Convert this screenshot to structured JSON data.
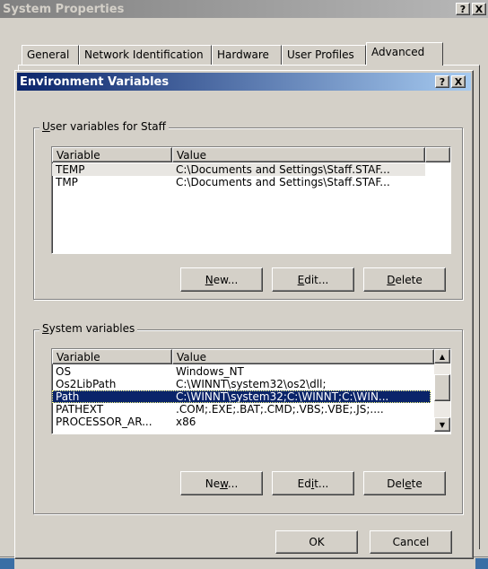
{
  "outer_window": {
    "title": "System Properties",
    "help_button": "?",
    "close_button": "X",
    "tabs": [
      "General",
      "Network Identification",
      "Hardware",
      "User Profiles",
      "Advanced"
    ],
    "active_tab": "Advanced"
  },
  "dialog": {
    "title": "Environment Variables",
    "help_button": "?",
    "close_button": "X",
    "user_group": {
      "label_accel": "U",
      "label_rest": "ser variables for Staff",
      "columns": [
        "Variable",
        "Value"
      ],
      "rows": [
        {
          "variable": "TEMP",
          "value": "C:\\Documents and Settings\\Staff.STAF..."
        },
        {
          "variable": "TMP",
          "value": "C:\\Documents and Settings\\Staff.STAF..."
        }
      ],
      "buttons": {
        "new_accel": "N",
        "new_rest": "ew...",
        "edit_accel": "E",
        "edit_rest": "dit...",
        "delete_accel": "D",
        "delete_rest": "elete"
      }
    },
    "system_group": {
      "label_accel": "S",
      "label_rest": "ystem variables",
      "columns": [
        "Variable",
        "Value"
      ],
      "rows": [
        {
          "variable": "OS",
          "value": "Windows_NT"
        },
        {
          "variable": "Os2LibPath",
          "value": "C:\\WINNT\\system32\\os2\\dll;"
        },
        {
          "variable": "Path",
          "value": "C:\\WINNT\\system32;C:\\WINNT;C:\\WIN..."
        },
        {
          "variable": "PATHEXT",
          "value": ".COM;.EXE;.BAT;.CMD;.VBS;.VBE;.JS;...."
        },
        {
          "variable": "PROCESSOR_AR...",
          "value": "x86"
        }
      ],
      "selected_row": "Path",
      "buttons": {
        "new_pre": "Ne",
        "new_accel": "w",
        "new_rest": "...",
        "edit_pre": "Ed",
        "edit_accel": "i",
        "edit_rest": "t...",
        "delete_pre": "Del",
        "delete_accel": "e",
        "delete_rest": "te"
      }
    },
    "ok_label": "OK",
    "cancel_label": "Cancel"
  },
  "colors": {
    "face": "#d4d0c8",
    "active_title": "#0a246a",
    "selection": "#0a246a"
  }
}
